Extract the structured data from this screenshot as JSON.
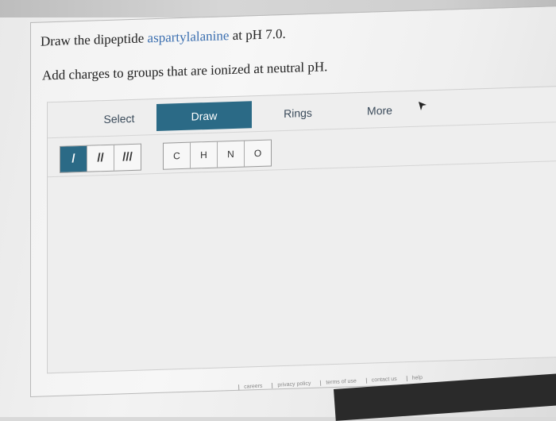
{
  "question": {
    "prefix": "Draw the dipeptide ",
    "term": "aspartylalanine",
    "suffix": " at pH 7.0.",
    "instructions": "Add charges to groups that are ionized at neutral pH."
  },
  "toolbar": {
    "tabs": [
      {
        "label": "Select",
        "active": false
      },
      {
        "label": "Draw",
        "active": true
      },
      {
        "label": "Rings",
        "active": false
      },
      {
        "label": "More",
        "active": false
      }
    ],
    "bonds": [
      {
        "label": "/",
        "name": "single-bond",
        "active": true
      },
      {
        "label": "//",
        "name": "double-bond",
        "active": false
      },
      {
        "label": "///",
        "name": "triple-bond",
        "active": false
      }
    ],
    "atoms": [
      "C",
      "H",
      "N",
      "O"
    ]
  },
  "footer": {
    "links": [
      "careers",
      "privacy policy",
      "terms of use",
      "contact us",
      "help"
    ]
  },
  "colors": {
    "accent": "#2b6a86",
    "link": "#3b6fb0"
  }
}
